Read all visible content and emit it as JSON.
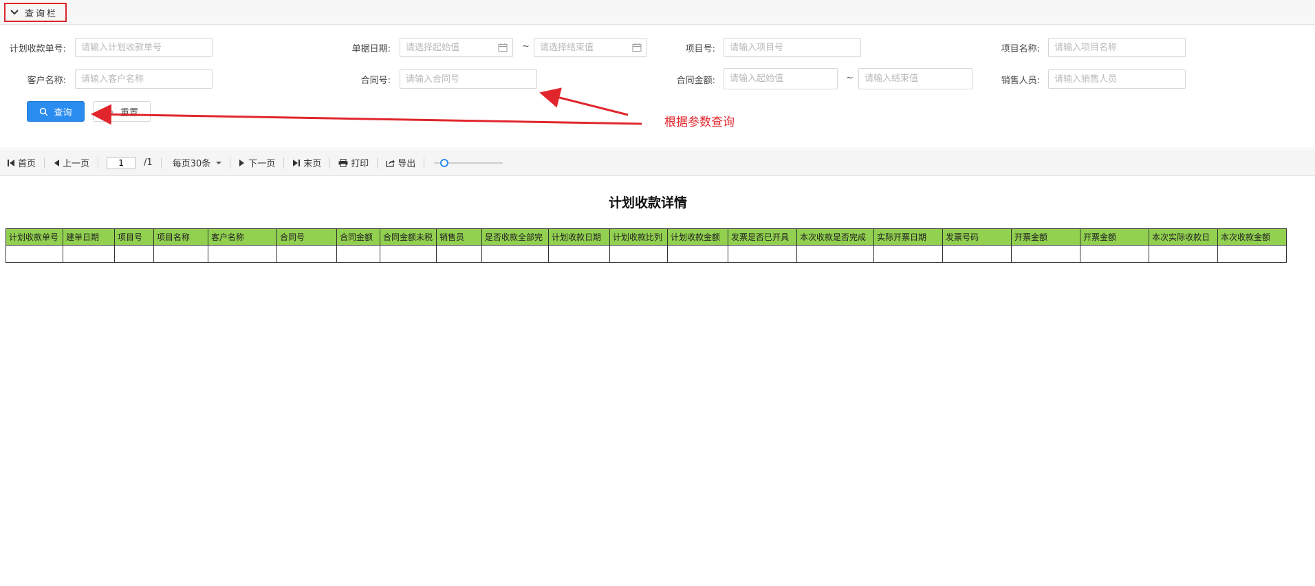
{
  "query_bar": {
    "title": "查询栏",
    "fields": {
      "plan_no": {
        "label": "计划收款单号:",
        "placeholder": "请输入计划收款单号"
      },
      "doc_date": {
        "label": "单据日期:",
        "start_placeholder": "请选择起始值",
        "end_placeholder": "请选择结束值",
        "range_sep": "~"
      },
      "project_no": {
        "label": "项目号:",
        "placeholder": "请输入项目号"
      },
      "project_name": {
        "label": "项目名称:",
        "placeholder": "请输入项目名称"
      },
      "customer_name": {
        "label": "客户名称:",
        "placeholder": "请输入客户名称"
      },
      "contract_no": {
        "label": "合同号:",
        "placeholder": "请输入合同号"
      },
      "contract_amount": {
        "label": "合同金额:",
        "start_placeholder": "请输入起始值",
        "end_placeholder": "请输入结束值",
        "range_sep": "~"
      },
      "sales_person": {
        "label": "销售人员:",
        "placeholder": "请输入销售人员"
      }
    },
    "query_button": "查询",
    "reset_button": "重置"
  },
  "annotation": {
    "text": "根据参数查询",
    "color": "#e0262c"
  },
  "toolbar": {
    "first": "首页",
    "prev": "上一页",
    "page_value": "1",
    "page_total": "/1",
    "page_size": "每页30条",
    "next": "下一页",
    "last": "末页",
    "print": "打印",
    "export": "导出",
    "zoom_level": 0.1
  },
  "report": {
    "title": "计划收款详情",
    "header_color": "#92d050",
    "columns": [
      "计划收款单号",
      "建单日期",
      "项目号",
      "项目名称",
      "客户名称",
      "合同号",
      "合同金额",
      "合同金额未税",
      "销售员",
      "是否收款全部完",
      "计划收款日期",
      "计划收款比列",
      "计划收款金额",
      "发票是否已开具",
      "本次收款是否完成",
      "实际开票日期",
      "发票号码",
      "开票金额",
      "开票金额",
      "本次实际收款日",
      "本次收款金额"
    ]
  },
  "colors": {
    "primary": "#2b8cf0",
    "annotation": "#e0262c"
  }
}
